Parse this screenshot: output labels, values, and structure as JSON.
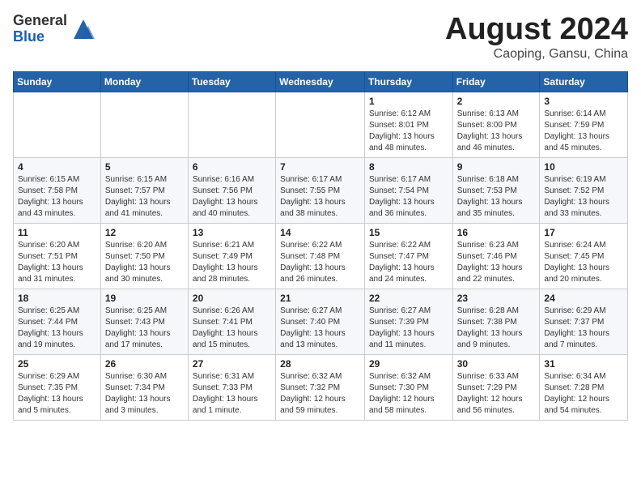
{
  "header": {
    "logo_general": "General",
    "logo_blue": "Blue",
    "month_title": "August 2024",
    "location": "Caoping, Gansu, China"
  },
  "days_of_week": [
    "Sunday",
    "Monday",
    "Tuesday",
    "Wednesday",
    "Thursday",
    "Friday",
    "Saturday"
  ],
  "weeks": [
    [
      {
        "day": "",
        "info": ""
      },
      {
        "day": "",
        "info": ""
      },
      {
        "day": "",
        "info": ""
      },
      {
        "day": "",
        "info": ""
      },
      {
        "day": "1",
        "info": "Sunrise: 6:12 AM\nSunset: 8:01 PM\nDaylight: 13 hours\nand 48 minutes."
      },
      {
        "day": "2",
        "info": "Sunrise: 6:13 AM\nSunset: 8:00 PM\nDaylight: 13 hours\nand 46 minutes."
      },
      {
        "day": "3",
        "info": "Sunrise: 6:14 AM\nSunset: 7:59 PM\nDaylight: 13 hours\nand 45 minutes."
      }
    ],
    [
      {
        "day": "4",
        "info": "Sunrise: 6:15 AM\nSunset: 7:58 PM\nDaylight: 13 hours\nand 43 minutes."
      },
      {
        "day": "5",
        "info": "Sunrise: 6:15 AM\nSunset: 7:57 PM\nDaylight: 13 hours\nand 41 minutes."
      },
      {
        "day": "6",
        "info": "Sunrise: 6:16 AM\nSunset: 7:56 PM\nDaylight: 13 hours\nand 40 minutes."
      },
      {
        "day": "7",
        "info": "Sunrise: 6:17 AM\nSunset: 7:55 PM\nDaylight: 13 hours\nand 38 minutes."
      },
      {
        "day": "8",
        "info": "Sunrise: 6:17 AM\nSunset: 7:54 PM\nDaylight: 13 hours\nand 36 minutes."
      },
      {
        "day": "9",
        "info": "Sunrise: 6:18 AM\nSunset: 7:53 PM\nDaylight: 13 hours\nand 35 minutes."
      },
      {
        "day": "10",
        "info": "Sunrise: 6:19 AM\nSunset: 7:52 PM\nDaylight: 13 hours\nand 33 minutes."
      }
    ],
    [
      {
        "day": "11",
        "info": "Sunrise: 6:20 AM\nSunset: 7:51 PM\nDaylight: 13 hours\nand 31 minutes."
      },
      {
        "day": "12",
        "info": "Sunrise: 6:20 AM\nSunset: 7:50 PM\nDaylight: 13 hours\nand 30 minutes."
      },
      {
        "day": "13",
        "info": "Sunrise: 6:21 AM\nSunset: 7:49 PM\nDaylight: 13 hours\nand 28 minutes."
      },
      {
        "day": "14",
        "info": "Sunrise: 6:22 AM\nSunset: 7:48 PM\nDaylight: 13 hours\nand 26 minutes."
      },
      {
        "day": "15",
        "info": "Sunrise: 6:22 AM\nSunset: 7:47 PM\nDaylight: 13 hours\nand 24 minutes."
      },
      {
        "day": "16",
        "info": "Sunrise: 6:23 AM\nSunset: 7:46 PM\nDaylight: 13 hours\nand 22 minutes."
      },
      {
        "day": "17",
        "info": "Sunrise: 6:24 AM\nSunset: 7:45 PM\nDaylight: 13 hours\nand 20 minutes."
      }
    ],
    [
      {
        "day": "18",
        "info": "Sunrise: 6:25 AM\nSunset: 7:44 PM\nDaylight: 13 hours\nand 19 minutes."
      },
      {
        "day": "19",
        "info": "Sunrise: 6:25 AM\nSunset: 7:43 PM\nDaylight: 13 hours\nand 17 minutes."
      },
      {
        "day": "20",
        "info": "Sunrise: 6:26 AM\nSunset: 7:41 PM\nDaylight: 13 hours\nand 15 minutes."
      },
      {
        "day": "21",
        "info": "Sunrise: 6:27 AM\nSunset: 7:40 PM\nDaylight: 13 hours\nand 13 minutes."
      },
      {
        "day": "22",
        "info": "Sunrise: 6:27 AM\nSunset: 7:39 PM\nDaylight: 13 hours\nand 11 minutes."
      },
      {
        "day": "23",
        "info": "Sunrise: 6:28 AM\nSunset: 7:38 PM\nDaylight: 13 hours\nand 9 minutes."
      },
      {
        "day": "24",
        "info": "Sunrise: 6:29 AM\nSunset: 7:37 PM\nDaylight: 13 hours\nand 7 minutes."
      }
    ],
    [
      {
        "day": "25",
        "info": "Sunrise: 6:29 AM\nSunset: 7:35 PM\nDaylight: 13 hours\nand 5 minutes."
      },
      {
        "day": "26",
        "info": "Sunrise: 6:30 AM\nSunset: 7:34 PM\nDaylight: 13 hours\nand 3 minutes."
      },
      {
        "day": "27",
        "info": "Sunrise: 6:31 AM\nSunset: 7:33 PM\nDaylight: 13 hours\nand 1 minute."
      },
      {
        "day": "28",
        "info": "Sunrise: 6:32 AM\nSunset: 7:32 PM\nDaylight: 12 hours\nand 59 minutes."
      },
      {
        "day": "29",
        "info": "Sunrise: 6:32 AM\nSunset: 7:30 PM\nDaylight: 12 hours\nand 58 minutes."
      },
      {
        "day": "30",
        "info": "Sunrise: 6:33 AM\nSunset: 7:29 PM\nDaylight: 12 hours\nand 56 minutes."
      },
      {
        "day": "31",
        "info": "Sunrise: 6:34 AM\nSunset: 7:28 PM\nDaylight: 12 hours\nand 54 minutes."
      }
    ]
  ]
}
